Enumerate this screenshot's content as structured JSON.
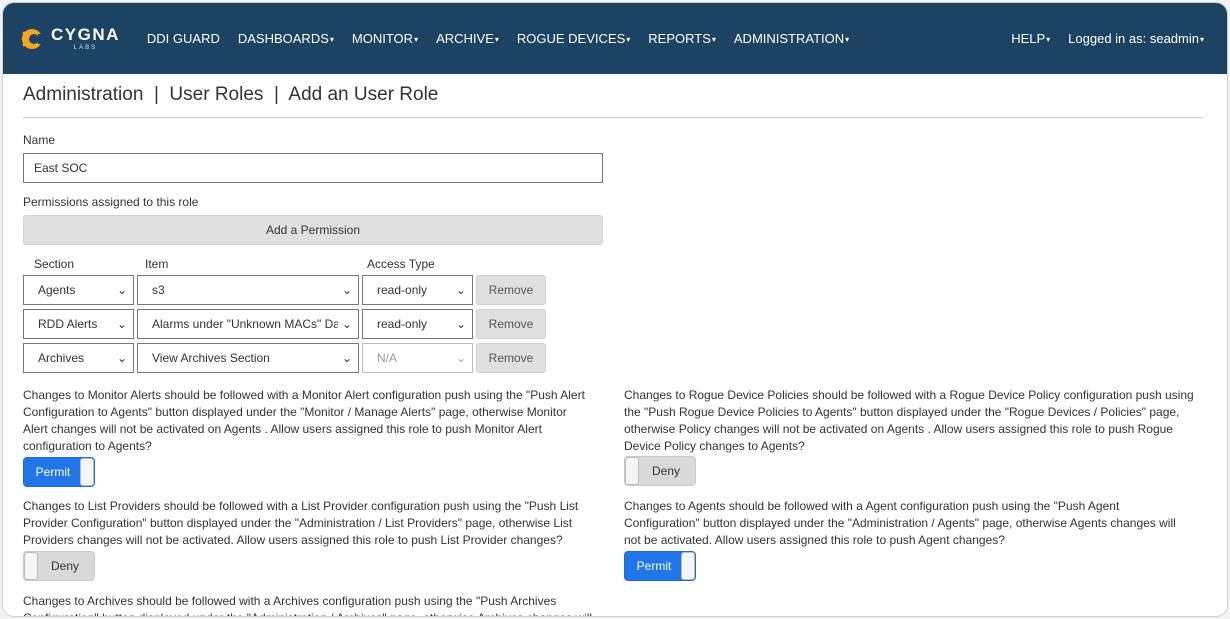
{
  "brand": {
    "name": "CYGNA",
    "sub": "LABS"
  },
  "nav": {
    "items": [
      {
        "label": "DDI GUARD",
        "caret": ""
      },
      {
        "label": "DASHBOARDS",
        "caret": "▾"
      },
      {
        "label": "MONITOR",
        "caret": "▾"
      },
      {
        "label": "ARCHIVE",
        "caret": "▾"
      },
      {
        "label": "ROGUE DEVICES",
        "caret": "▾"
      },
      {
        "label": "REPORTS",
        "caret": "▾"
      },
      {
        "label": "ADMINISTRATION",
        "caret": "▾"
      }
    ],
    "help": "HELP",
    "user": "Logged in as: seadmin"
  },
  "page": {
    "title": "Administration  |  User Roles  |  Add an User Role",
    "name_label": "Name",
    "name_value": "East SOC",
    "permissions_label": "Permissions assigned to this role",
    "add_permission": "Add a Permission",
    "headers": {
      "section": "Section",
      "item": "Item",
      "access": "Access Type"
    },
    "remove_label": "Remove",
    "rows": [
      {
        "section": "Agents",
        "item": "s3",
        "access": "read-only",
        "access_disabled": false
      },
      {
        "section": "RDD Alerts",
        "item": "Alarms under \"Unknown MACs\" Dashboard",
        "access": "read-only",
        "access_disabled": false
      },
      {
        "section": "Archives",
        "item": "View Archives Section",
        "access": "N/A",
        "access_disabled": true
      }
    ]
  },
  "options": {
    "monitor_alerts": {
      "text": "Changes to Monitor Alerts should be followed with a Monitor Alert configuration push using the \"Push Alert Configuration to Agents\" button displayed under the \"Monitor / Manage Alerts\" page, otherwise Monitor Alert changes will not be activated on Agents . Allow users assigned this role to push Monitor Alert configuration to Agents?",
      "state": "Permit"
    },
    "rogue_policies": {
      "text": "Changes to Rogue Device Policies should be followed with a Rogue Device Policy configuration push using the \"Push Rogue Device Policies to Agents\" button displayed under the \"Rogue Devices / Policies\" page, otherwise Policy changes will not be activated on Agents . Allow users assigned this role to push Rogue Device Policy changes to Agents?",
      "state": "Deny"
    },
    "list_providers": {
      "text": "Changes to List Providers should be followed with a List Provider configuration push using the \"Push List Provider Configuration\" button displayed under the \"Administration / List Providers\" page, otherwise List Providers changes will not be activated. Allow users assigned this role to push List Provider changes?",
      "state": "Deny"
    },
    "agents": {
      "text": "Changes to Agents should be followed with a Agent configuration push using the \"Push Agent Configuration\" button displayed under the \"Administration / Agents\" page, otherwise Agents changes will not be activated. Allow users assigned this role to push Agent changes?",
      "state": "Permit"
    },
    "archives": {
      "text": "Changes to Archives should be followed with a Archives configuration push using the \"Push Archives Configuration\" button displayed under the \"Administration / Archives\" page, otherwise Archives changes will not be activated."
    }
  },
  "colors": {
    "navbar": "#1c4361",
    "permit": "#2275e8",
    "deny": "#d9d9d9",
    "logo_accent": "#f5a623"
  }
}
